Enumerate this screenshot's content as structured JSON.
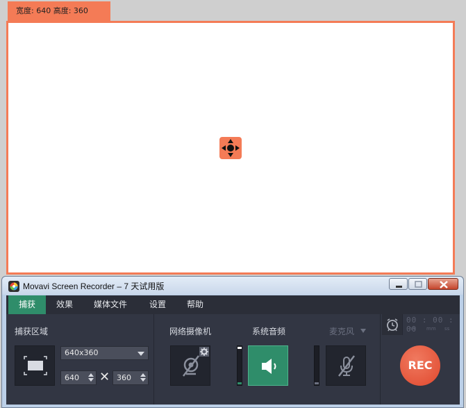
{
  "capture_frame": {
    "size_label": "宽度: 640  高度: 360"
  },
  "window": {
    "title": "Movavi Screen Recorder – 7 天试用版"
  },
  "menu": {
    "items": [
      {
        "label": "捕获",
        "active": true
      },
      {
        "label": "效果",
        "active": false
      },
      {
        "label": "媒体文件",
        "active": false
      },
      {
        "label": "设置",
        "active": false
      },
      {
        "label": "帮助",
        "active": false
      }
    ]
  },
  "capture_area": {
    "label": "捕获区域",
    "preset": "640x360",
    "width": "640",
    "height": "360",
    "times": "✕"
  },
  "sources": {
    "webcam_label": "网络摄像机",
    "system_audio_label": "系统音频",
    "microphone_label": "麦克风"
  },
  "recording": {
    "timer": "00 : 00 : 00",
    "timer_units": [
      "hh",
      "mm",
      "ss"
    ],
    "rec_label": "REC"
  },
  "colors": {
    "accent_orange": "#f47b56",
    "active_green": "#2f8d6a",
    "rec_red": "#e0482d",
    "panel_dark": "#323643"
  }
}
